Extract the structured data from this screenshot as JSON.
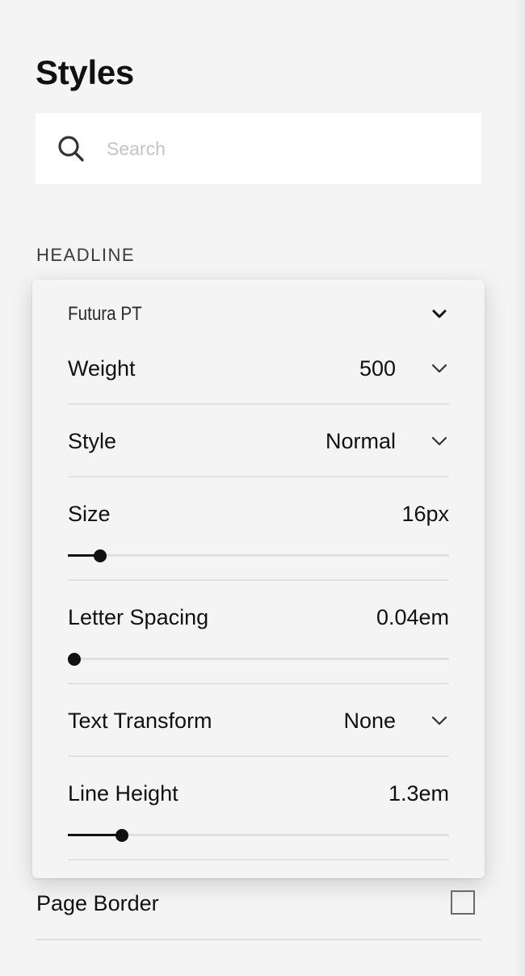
{
  "page": {
    "title": "Styles"
  },
  "search": {
    "placeholder": "Search",
    "value": ""
  },
  "section": {
    "label": "HEADLINE"
  },
  "headline_panel": {
    "font_family": "Futura PT",
    "weight": {
      "label": "Weight",
      "value": "500"
    },
    "style": {
      "label": "Style",
      "value": "Normal"
    },
    "size": {
      "label": "Size",
      "value": "16px",
      "slider_fraction": 0.085
    },
    "letter_spacing": {
      "label": "Letter Spacing",
      "value": "0.04em",
      "slider_fraction": 0.015
    },
    "text_transform": {
      "label": "Text Transform",
      "value": "None"
    },
    "line_height": {
      "label": "Line Height",
      "value": "1.3em",
      "slider_fraction": 0.142
    }
  },
  "page_border": {
    "label": "Page Border",
    "checked": false
  },
  "icons": {
    "search": "search-icon",
    "dropdown": "chevron-down-icon"
  }
}
